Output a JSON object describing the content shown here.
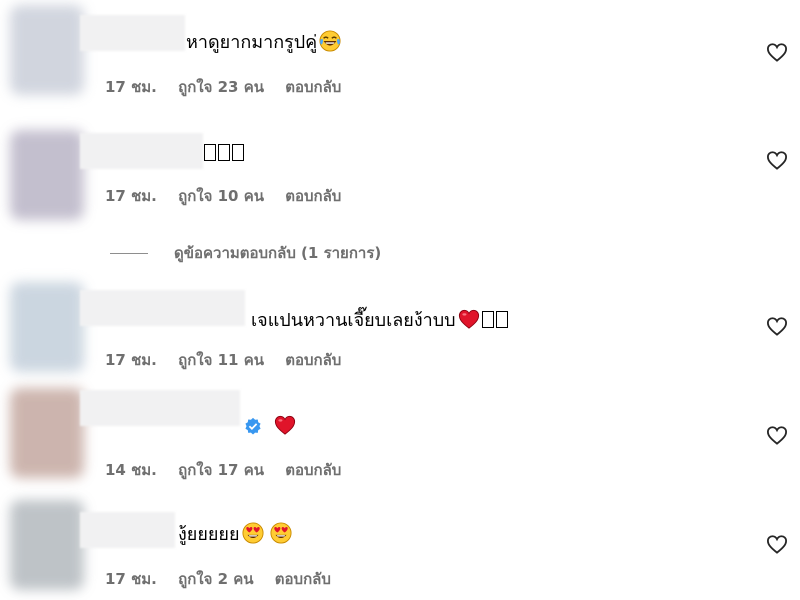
{
  "comments": [
    {
      "text": "หาดูยากมากรูปคู่",
      "time": "17 ชม.",
      "likes": "ถูกใจ 23 คน",
      "reply": "ตอบกลับ",
      "avatar_color": "#c9ced9"
    },
    {
      "text": "",
      "time": "17 ชม.",
      "likes": "ถูกใจ 10 คน",
      "reply": "ตอบกลับ",
      "avatar_color": "#b9b4c6"
    },
    {
      "text": "เจแปนหวานเจี๊ยบเลยง้าบบ",
      "time": "17 ชม.",
      "likes": "ถูกใจ 11 คน",
      "reply": "ตอบกลับ",
      "avatar_color": "#c3cfdb"
    },
    {
      "text": "",
      "time": "14 ชม.",
      "likes": "ถูกใจ 17 คน",
      "reply": "ตอบกลับ",
      "avatar_color": "#c4a8a0"
    },
    {
      "text": "งู้ยยยยย",
      "time": "17 ชม.",
      "likes": "ถูกใจ 2 คน",
      "reply": "ตอบกลับ",
      "avatar_color": "#b3b9be"
    }
  ],
  "view_replies": "ดูข้อความตอบกลับ (1 รายการ)",
  "icons": {
    "like": "heart-outline-icon",
    "verified": "verified-badge-icon",
    "emoji_laugh": "tears-of-joy-emoji",
    "emoji_heart": "red-heart-emoji",
    "emoji_heart_eyes": "heart-eyes-emoji"
  }
}
